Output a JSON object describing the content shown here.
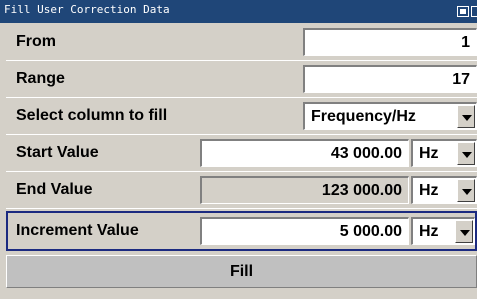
{
  "window": {
    "title": "Fill User Correction Data"
  },
  "rows": {
    "from": {
      "label": "From",
      "value": "1"
    },
    "range": {
      "label": "Range",
      "value": "17"
    },
    "column": {
      "label": "Select column to fill",
      "value": "Frequency/Hz"
    },
    "start": {
      "label": "Start Value",
      "value": "43 000.00",
      "unit": "Hz"
    },
    "end": {
      "label": "End Value",
      "value": "123 000.00",
      "unit": "Hz"
    },
    "increment": {
      "label": "Increment Value",
      "value": "5 000.00",
      "unit": "Hz"
    }
  },
  "fill_button": {
    "label": "Fill"
  },
  "colors": {
    "titlebar": "#1f4678",
    "background": "#d4d0c8",
    "focus_border": "#1b2a80"
  },
  "icons": [
    "window-toggle-icon",
    "dropdown-arrow-icon"
  ]
}
